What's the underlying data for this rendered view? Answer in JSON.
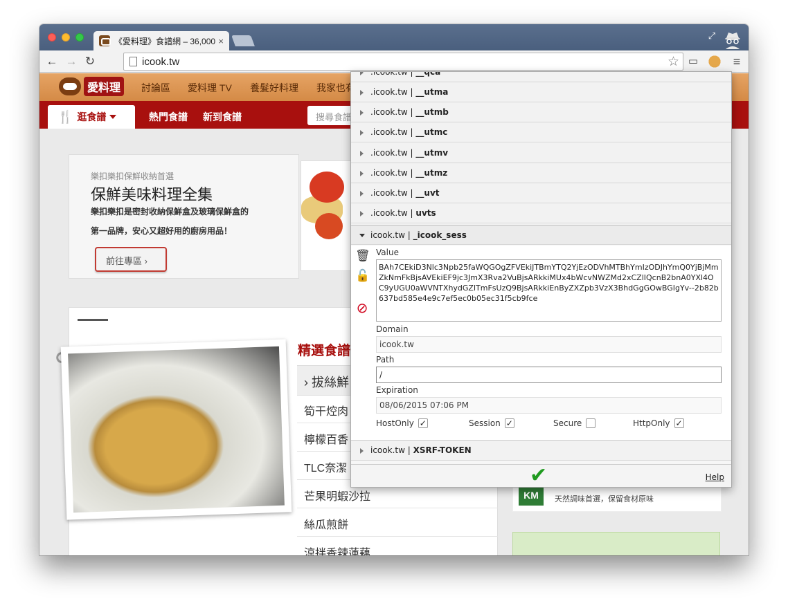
{
  "browser": {
    "tab_title": "《愛料理》食譜網 – 36,000",
    "tab_close": "×",
    "url": "icook.tw",
    "icons": [
      "back-icon",
      "forward-icon",
      "reload-icon",
      "page-icon",
      "star-icon",
      "cast-icon",
      "cookie-extension-icon",
      "menu-icon",
      "incognito-icon",
      "fullscreen-icon"
    ]
  },
  "site": {
    "logo_text": "愛料理",
    "top_nav": [
      "討論區",
      "愛料理 TV",
      "養髮好料理",
      "我家也有"
    ],
    "browse_label": "逛食譜",
    "red_nav": [
      "熱門食譜",
      "新到食譜"
    ],
    "search_placeholder": "搜尋食譜",
    "promo": {
      "kicker": "樂扣樂扣保鮮收納首選",
      "headline": "保鮮美味料理全集",
      "desc1": "樂扣樂扣是密封收納保鮮盒及玻璃保鮮盒的",
      "desc2": "第一品牌，安心又超好用的廚房用品！",
      "button": "前往專區"
    },
    "section_title": "精選食譜",
    "category_item": "拔絲鮮",
    "recipes": [
      "筍干焢肉",
      "檸檬百香",
      "TLC奈潔",
      "芒果明蝦沙拉",
      "絲瓜煎餅",
      "涼拌香辣蓮藕"
    ],
    "ad_tagline": "天然調味首選，保留食材原味"
  },
  "cookie_popup": {
    "rows_above": [
      {
        "domain": ".icook.tw",
        "name": "__qca"
      },
      {
        "domain": ".icook.tw",
        "name": "__utma"
      },
      {
        "domain": ".icook.tw",
        "name": "__utmb"
      },
      {
        "domain": ".icook.tw",
        "name": "__utmc"
      },
      {
        "domain": ".icook.tw",
        "name": "__utmv"
      },
      {
        "domain": ".icook.tw",
        "name": "__utmz"
      },
      {
        "domain": ".icook.tw",
        "name": "__uvt"
      },
      {
        "domain": ".icook.tw",
        "name": "uvts"
      }
    ],
    "active_row": {
      "domain": "icook.tw",
      "name": "_icook_sess"
    },
    "separator": "|",
    "labels": {
      "value": "Value",
      "domain": "Domain",
      "path": "Path",
      "expiration": "Expiration"
    },
    "value": "BAh7CEkiD3Nlc3Npb25faWQGOgZFVEkiJTBmYTQ2YjEzODVhMTBhYmIzODJhYmQ0YjBjMmZkNmFkBjsAVEkiEF9jc3JmX3Rva2VuBjsARkkiMUx4bWcvNWZMd2xCZlIQcnB2bnA0YXl4OC9yUGU0aWVNTXhydGZlTmFsUzQ9BjsARkkiEnByZXZpb3VzX3BhdGgGOwBGIgYv--2b82b637bd585e4e9c7ef5ec0b05ec31f5cb9fce",
    "domain": "icook.tw",
    "path": "/",
    "expiration": "08/06/2015 07:06 PM",
    "flags": [
      {
        "label": "HostOnly",
        "checked": true
      },
      {
        "label": "Session",
        "checked": true
      },
      {
        "label": "Secure",
        "checked": false
      },
      {
        "label": "HttpOnly",
        "checked": true
      }
    ],
    "row_below": {
      "domain": "icook.tw",
      "name": "XSRF-TOKEN"
    },
    "help": "Help",
    "check_mark": "✔"
  }
}
